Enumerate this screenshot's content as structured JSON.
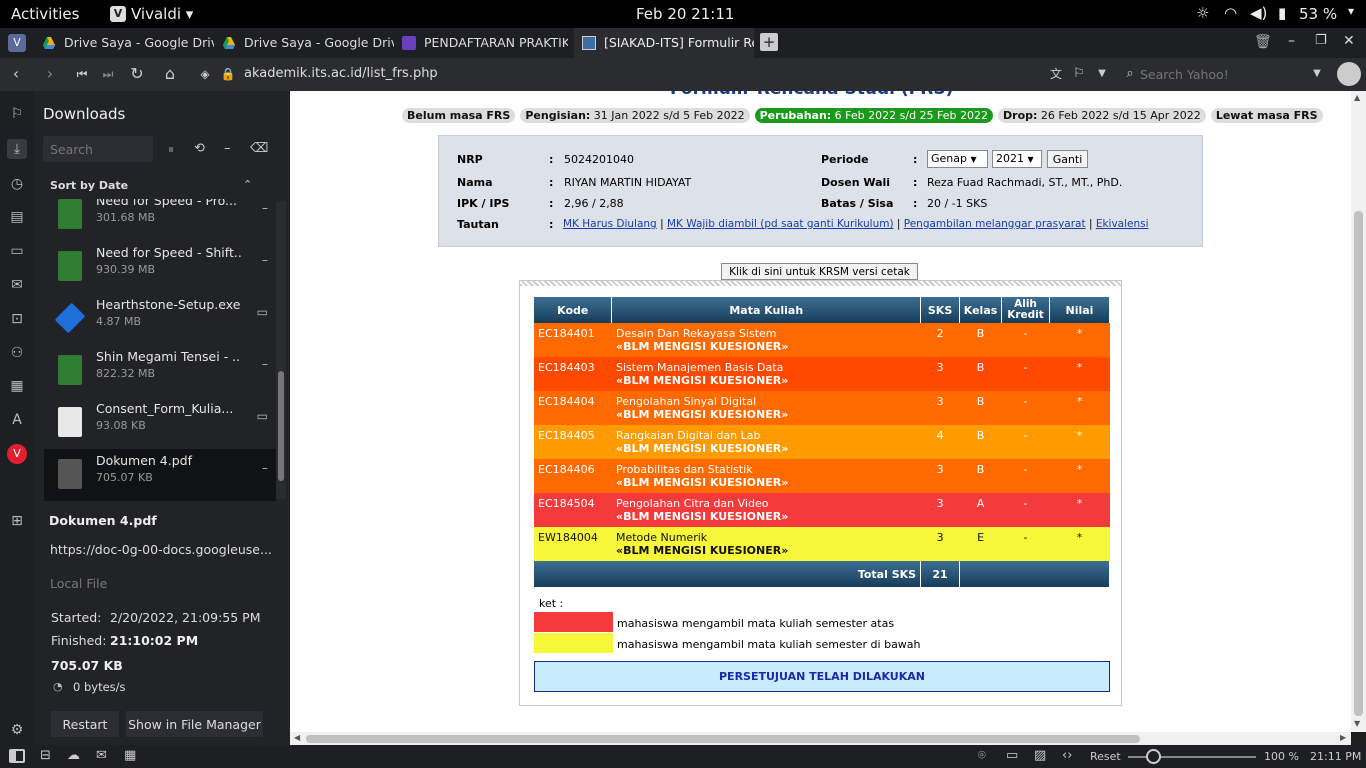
{
  "system": {
    "activities": "Activities",
    "app": "Vivaldi",
    "clock": "Feb 20  21:11",
    "battery": "53 %"
  },
  "tabs": [
    {
      "title": "Drive Saya - Google Drive"
    },
    {
      "title": "Drive Saya - Google Drive"
    },
    {
      "title": "PENDAFTARAN PRAKTIKU"
    },
    {
      "title": "[SIAKAD-ITS] Formulir Rer"
    }
  ],
  "address": {
    "url": "akademik.its.ac.id/list_frs.php",
    "search_placeholder": "Search Yahoo!"
  },
  "downloads": {
    "title": "Downloads",
    "search_placeholder": "Search",
    "sort_label": "Sort by Date",
    "items": [
      {
        "name": "Need for Speed - Pro...",
        "size": "301.68 MB",
        "color": "#2e7d32"
      },
      {
        "name": "Need for Speed - Shift...",
        "size": "930.39 MB",
        "color": "#2e7d32"
      },
      {
        "name": "Hearthstone-Setup.exe",
        "size": "4.87 MB",
        "color": "#1e6fd9"
      },
      {
        "name": "Shin Megami Tensei - ...",
        "size": "822.32 MB",
        "color": "#2e7d32"
      },
      {
        "name": "Consent_Form_Kulia...",
        "size": "93.08 KB",
        "color": "#e8e8e8"
      },
      {
        "name": "Dokumen 4.pdf",
        "size": "705.07 KB",
        "color": "#555"
      }
    ],
    "detail": {
      "name": "Dokumen 4.pdf",
      "url": "https://doc-0g-00-docs.googleuse...",
      "local": "Local File",
      "started_label": "Started:",
      "started": "2/20/2022, 21:09:55 PM",
      "finished_label": "Finished:",
      "finished": "21:10:02 PM",
      "size": "705.07 KB",
      "speed": "0 bytes/s",
      "restart": "Restart",
      "show": "Show in File Manager"
    }
  },
  "page": {
    "heading_partial": "Formulir Rencana Studi (FRS)",
    "phases": [
      {
        "label": "Belum masa FRS",
        "value": "",
        "green": false
      },
      {
        "label": "Pengisian:",
        "value": " 31 Jan 2022 s/d 5 Feb 2022",
        "green": false
      },
      {
        "label": "Perubahan:",
        "value": " 6 Feb 2022 s/d 25 Feb 2022",
        "green": true
      },
      {
        "label": "Drop:",
        "value": " 26 Feb 2022 s/d 15 Apr 2022",
        "green": false
      },
      {
        "label": "Lewat masa FRS",
        "value": "",
        "green": false
      }
    ],
    "info": {
      "nrp_label": "NRP",
      "nrp": "5024201040",
      "nama_label": "Nama",
      "nama": "RIYAN MARTIN HIDAYAT",
      "ipk_label": "IPK / IPS",
      "ipk": "2,96 / 2,88",
      "tautan_label": "Tautan",
      "links": [
        "MK Harus Diulang",
        "MK Wajib diambil (pd saat ganti Kurikulum)",
        "Pengambilan melanggar prasyarat",
        "Ekivalensi"
      ],
      "periode_label": "Periode",
      "semester": "Genap",
      "year": "2021",
      "ganti": "Ganti",
      "dosen_label": "Dosen Wali",
      "dosen": "Reza Fuad Rachmadi, ST., MT., PhD.",
      "batas_label": "Batas / Sisa",
      "batas": "20 / -1 SKS"
    },
    "print_button": "Klik di sini untuk KRSM versi cetak",
    "table": {
      "headers": [
        "Kode",
        "Mata Kuliah",
        "SKS",
        "Kelas",
        "Alih Kredit",
        "Nilai"
      ],
      "note": "«BLM MENGISI KUESIONER»",
      "rows": [
        {
          "kode": "EC184401",
          "mk": "Desain Dan Rekayasa Sistem",
          "sks": "2",
          "kelas": "B",
          "alih": "-",
          "nilai": "*",
          "bg": "#ff6a00",
          "fg": "#fff"
        },
        {
          "kode": "EC184403",
          "mk": "Sistem Manajemen Basis Data",
          "sks": "3",
          "kelas": "B",
          "alih": "-",
          "nilai": "*",
          "bg": "#ff4800",
          "fg": "#fff"
        },
        {
          "kode": "EC184404",
          "mk": "Pengolahan Sinyal Digital",
          "sks": "3",
          "kelas": "B",
          "alih": "-",
          "nilai": "*",
          "bg": "#ff6a00",
          "fg": "#fff"
        },
        {
          "kode": "EC184405",
          "mk": "Rangkaian Digital dan Lab",
          "sks": "4",
          "kelas": "B",
          "alih": "-",
          "nilai": "*",
          "bg": "#ff9a00",
          "fg": "#fff"
        },
        {
          "kode": "EC184406",
          "mk": "Probabilitas dan Statistik",
          "sks": "3",
          "kelas": "B",
          "alih": "-",
          "nilai": "*",
          "bg": "#ff6a00",
          "fg": "#fff"
        },
        {
          "kode": "EC184504",
          "mk": "Pengolahan Citra dan Video",
          "sks": "3",
          "kelas": "A",
          "alih": "-",
          "nilai": "*",
          "bg": "#f43a3a",
          "fg": "#fff"
        },
        {
          "kode": "EW184004",
          "mk": "Metode Numerik",
          "sks": "3",
          "kelas": "E",
          "alih": "-",
          "nilai": "*",
          "bg": "#f7f73a",
          "fg": "#111"
        }
      ],
      "total_label": "Total SKS",
      "total": "21"
    },
    "ket_label": "ket :",
    "legend": [
      {
        "color": "#f43a3a",
        "text": "mahasiswa mengambil mata kuliah semester atas"
      },
      {
        "color": "#f7f73a",
        "text": "mahasiswa mengambil mata kuliah semester di bawah"
      }
    ],
    "approval": "PERSETUJUAN TELAH DILAKUKAN"
  },
  "status": {
    "reset": "Reset",
    "zoom": "100 %",
    "time": "21:11 PM"
  }
}
